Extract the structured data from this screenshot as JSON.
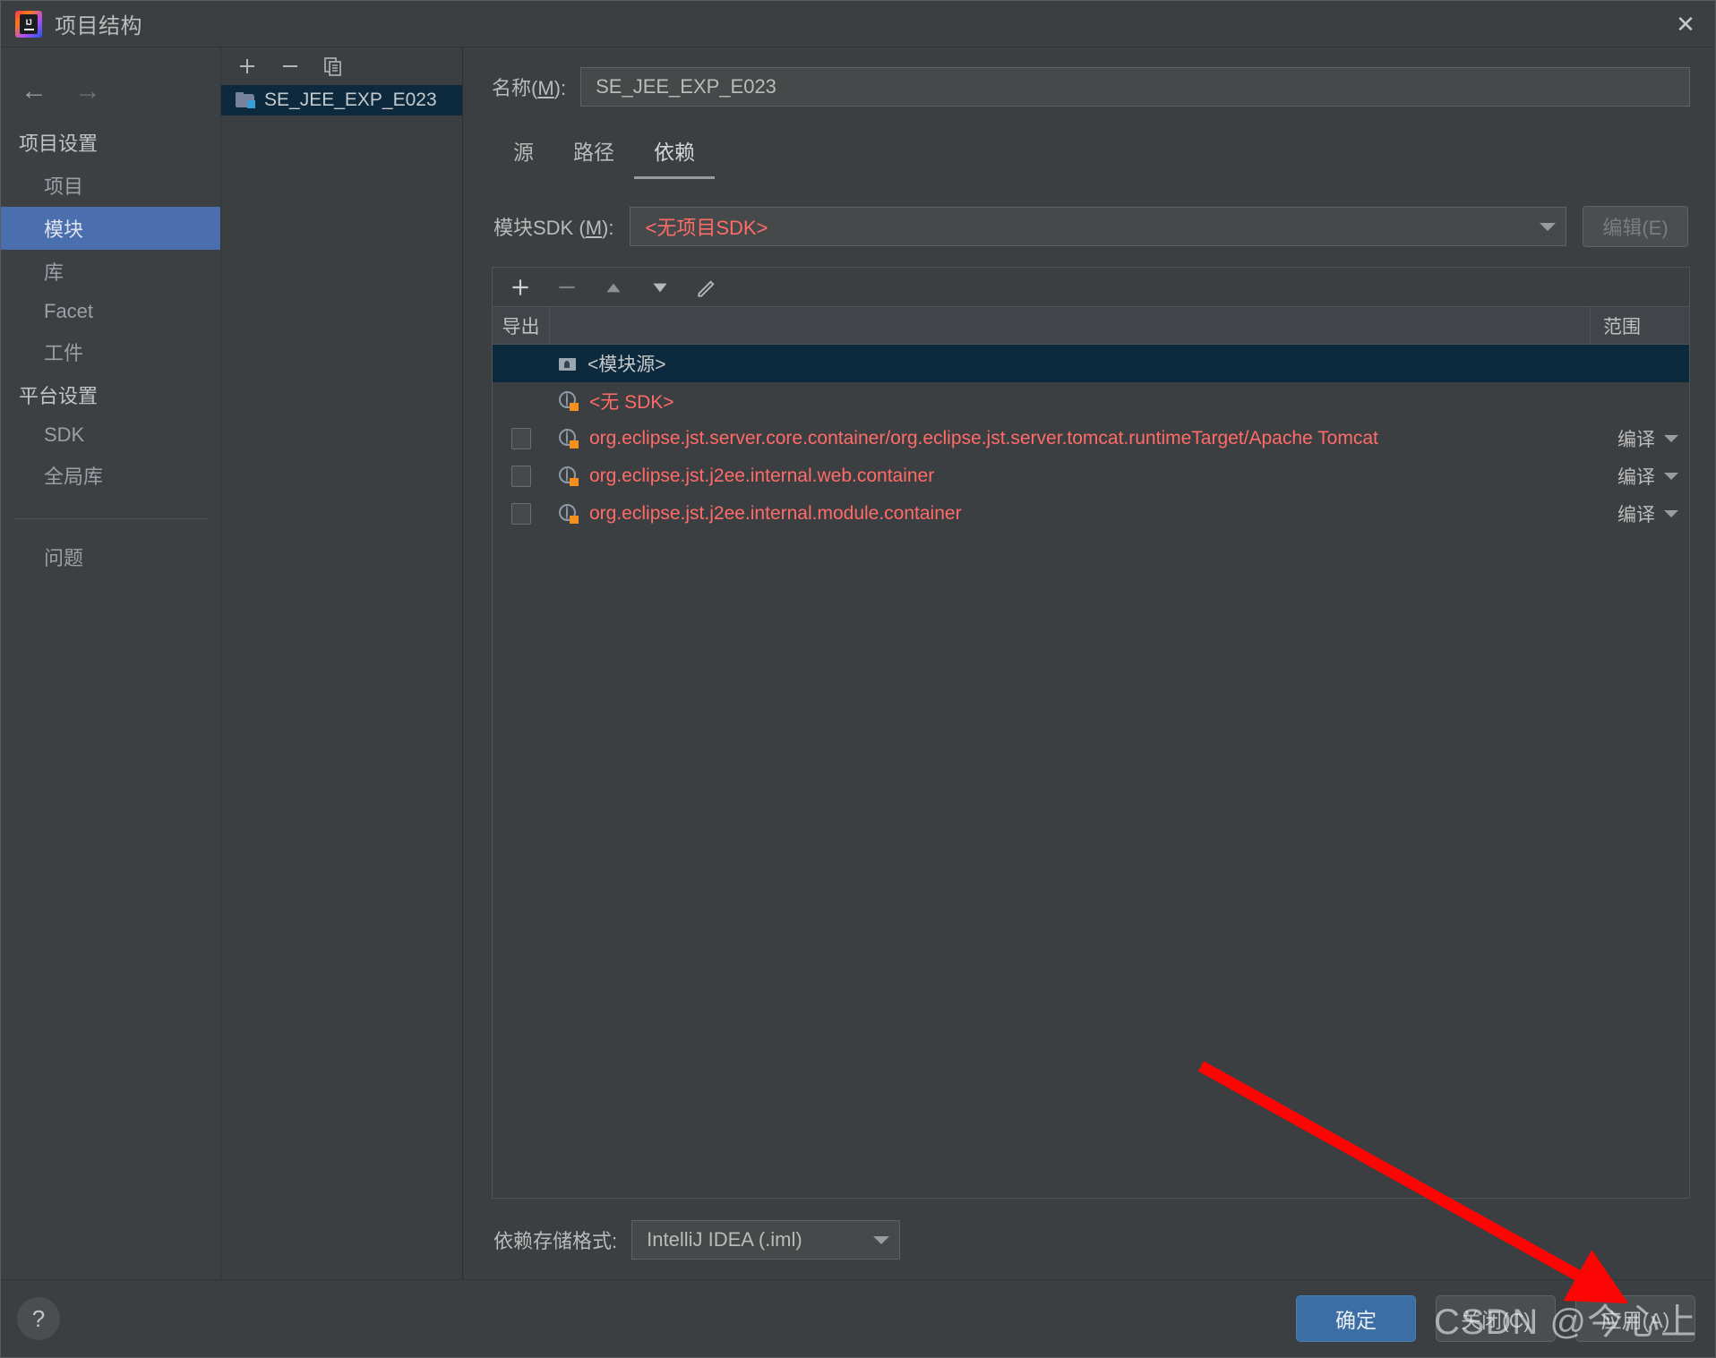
{
  "window": {
    "title": "项目结构",
    "logo_text": "IJ",
    "close_icon": "close-icon"
  },
  "nav": {
    "back_icon": "arrow-left-icon",
    "forward_icon": "arrow-right-icon"
  },
  "sidebar": {
    "groups": [
      {
        "label": "项目设置",
        "items": [
          {
            "label": "项目",
            "selected": false
          },
          {
            "label": "模块",
            "selected": true
          },
          {
            "label": "库",
            "selected": false
          },
          {
            "label": "Facet",
            "selected": false
          },
          {
            "label": "工件",
            "selected": false
          }
        ]
      },
      {
        "label": "平台设置",
        "items": [
          {
            "label": "SDK",
            "selected": false
          },
          {
            "label": "全局库",
            "selected": false
          }
        ]
      }
    ],
    "problems": "问题"
  },
  "module_list": {
    "toolbar": [
      {
        "name": "add-module-button",
        "glyph": "+"
      },
      {
        "name": "remove-module-button",
        "glyph": "−"
      },
      {
        "name": "copy-module-button",
        "glyph": "copy-icon"
      }
    ],
    "items": [
      {
        "label": "SE_JEE_EXP_E023",
        "selected": true
      }
    ]
  },
  "detail": {
    "name_label": "名称(M):",
    "name_label_prefix": "名称(",
    "name_label_mnemonic": "M",
    "name_label_suffix": "):",
    "name_value": "SE_JEE_EXP_E023",
    "tabs": [
      {
        "label": "源",
        "active": false
      },
      {
        "label": "路径",
        "active": false
      },
      {
        "label": "依赖",
        "active": true
      }
    ],
    "sdk_label_prefix": "模块SDK (",
    "sdk_label_mnemonic": "M",
    "sdk_label_suffix": "):",
    "sdk_value": "<无项目SDK>",
    "edit_button": "编辑(E)",
    "storage_label": "依赖存储格式:",
    "storage_value": "IntelliJ IDEA (.iml)"
  },
  "dependencies": {
    "toolbar": [
      {
        "name": "add-dependency-button",
        "glyph": "+"
      },
      {
        "name": "remove-dependency-button",
        "glyph": "−"
      },
      {
        "name": "move-up-button",
        "glyph": "triangle-up-icon"
      },
      {
        "name": "move-down-button",
        "glyph": "triangle-down-icon"
      },
      {
        "name": "edit-dependency-button",
        "glyph": "pencil-icon"
      }
    ],
    "columns": {
      "export": "导出",
      "scope": "范围"
    },
    "rows": [
      {
        "name": "<模块源>",
        "icon": "module-source-folder-icon",
        "color": "grey",
        "selected": true,
        "has_checkbox": false,
        "checked": false,
        "scope": ""
      },
      {
        "name": "<无 SDK>",
        "icon": "sdk-library-icon",
        "color": "red",
        "selected": false,
        "has_checkbox": false,
        "checked": false,
        "scope": ""
      },
      {
        "name": "org.eclipse.jst.server.core.container/org.eclipse.jst.server.tomcat.runtimeTarget/Apache Tomcat",
        "icon": "library-icon",
        "color": "red",
        "selected": false,
        "has_checkbox": true,
        "checked": false,
        "scope": "编译"
      },
      {
        "name": "org.eclipse.jst.j2ee.internal.web.container",
        "icon": "library-icon",
        "color": "red",
        "selected": false,
        "has_checkbox": true,
        "checked": false,
        "scope": "编译"
      },
      {
        "name": "org.eclipse.jst.j2ee.internal.module.container",
        "icon": "library-icon",
        "color": "red",
        "selected": false,
        "has_checkbox": true,
        "checked": false,
        "scope": "编译"
      }
    ]
  },
  "footer": {
    "help_glyph": "?",
    "buttons": [
      {
        "label": "确定",
        "style": "primary",
        "name": "ok-button"
      },
      {
        "label": "关闭(C)",
        "style": "normal",
        "name": "close-button"
      },
      {
        "label": "应用(A)",
        "style": "normal",
        "name": "apply-button"
      }
    ]
  },
  "overlay": {
    "watermark": "CSDN @今心上",
    "arrow_color": "#fb0505"
  },
  "colors": {
    "selection_blue": "#4b6eaf",
    "row_selection": "#0d293e",
    "error_red": "#ff6b68",
    "panel_bg": "#3c3f41",
    "primary_button": "#3a6ea5"
  }
}
